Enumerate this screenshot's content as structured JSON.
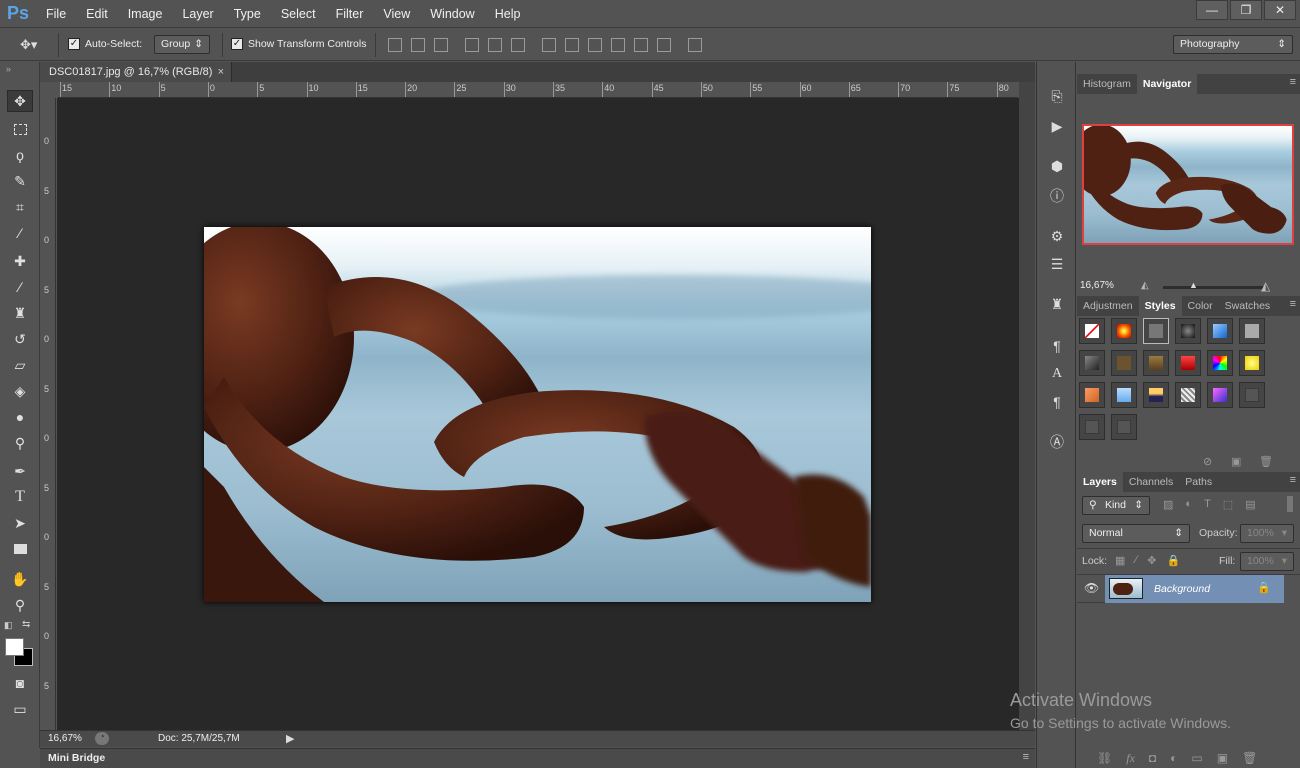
{
  "app": {
    "logo": "Ps"
  },
  "menu": [
    "File",
    "Edit",
    "Image",
    "Layer",
    "Type",
    "Select",
    "Filter",
    "View",
    "Window",
    "Help"
  ],
  "window_controls": {
    "minimize": "—",
    "restore": "❐",
    "close": "✕"
  },
  "options": {
    "auto_select_label": "Auto-Select:",
    "auto_select_checked": true,
    "auto_select_value": "Group",
    "transform_label": "Show Transform Controls",
    "transform_checked": true,
    "workspace": "Photography"
  },
  "document": {
    "tab_title": "DSC01817.jpg @ 16,7% (RGB/8)",
    "close": "×"
  },
  "ruler_h": [
    "15",
    "10",
    "5",
    "0",
    "5",
    "10",
    "15",
    "20",
    "25",
    "30",
    "35",
    "40",
    "45",
    "50",
    "55",
    "60",
    "65",
    "70",
    "75",
    "80"
  ],
  "ruler_v": [
    "0",
    "5",
    "0",
    "5",
    "0",
    "5",
    "0",
    "5",
    "0",
    "5",
    "0",
    "5",
    "0",
    "5"
  ],
  "status": {
    "zoom": "16,67%",
    "doc": "Doc: 25,7M/25,7M"
  },
  "minibridge": {
    "label": "Mini Bridge"
  },
  "navigator": {
    "tabs": [
      "Histogram",
      "Navigator"
    ],
    "active": "Navigator",
    "zoom": "16,67%"
  },
  "styles_panel": {
    "tabs": [
      "Adjustmen",
      "Styles",
      "Color",
      "Swatches"
    ],
    "active": "Styles"
  },
  "layers_panel": {
    "tabs": [
      "Layers",
      "Channels",
      "Paths"
    ],
    "active": "Layers",
    "kind": "Kind",
    "blend_mode": "Normal",
    "opacity_label": "Opacity:",
    "opacity_value": "100%",
    "lock_label": "Lock:",
    "fill_label": "Fill:",
    "fill_value": "100%",
    "layers": [
      {
        "name": "Background",
        "visible": true,
        "locked": true
      }
    ]
  },
  "watermark": {
    "line1": "Activate Windows",
    "line2": "Go to Settings to activate Windows."
  },
  "colors": {
    "accent": "#5ba4e6",
    "canvas_bg": "#282828",
    "panel_bg": "#535353",
    "layer_selected": "#7390b4",
    "navigator_frame": "#e04040"
  }
}
